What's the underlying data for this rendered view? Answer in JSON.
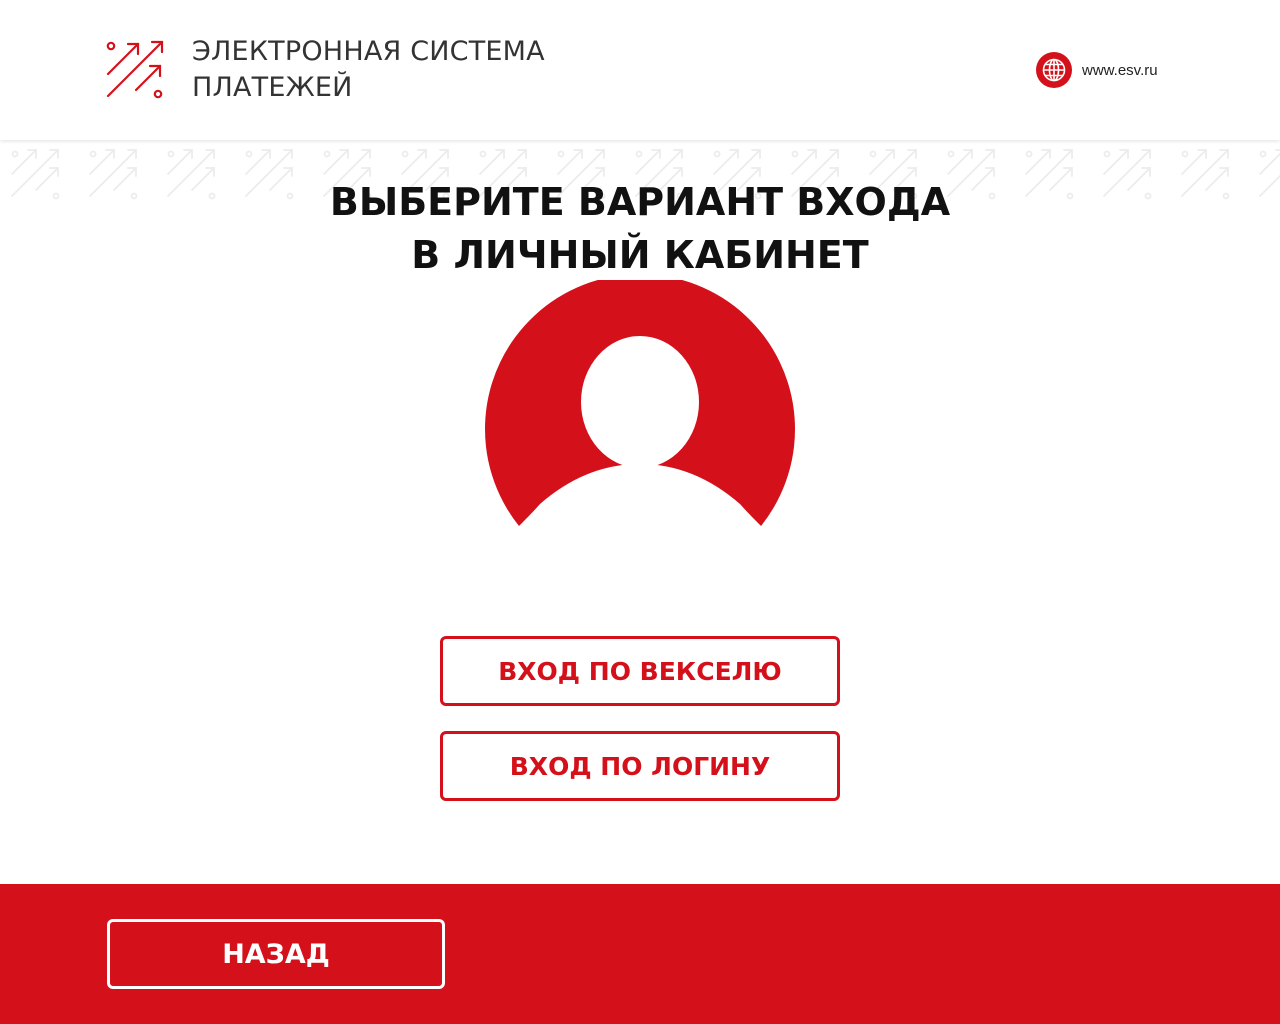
{
  "header": {
    "brand_line1": "ЭЛЕКТРОННАЯ СИСТЕМА",
    "brand_line2": "ПЛАТЕЖЕЙ",
    "site": "www.esv.ru"
  },
  "main": {
    "title_line1": "ВЫБЕРИТЕ ВАРИАНТ ВХОДА",
    "title_line2": "В ЛИЧНЫЙ КАБИНЕТ",
    "option_bill": "ВХОД ПО ВЕКСЕЛЮ",
    "option_login": "ВХОД ПО ЛОГИНУ"
  },
  "footer": {
    "back_label": "НАЗАД"
  },
  "icons": {
    "logo": "arrows-logo-icon",
    "site": "globe-icon",
    "avatar": "user-avatar-icon"
  },
  "colors": {
    "accent": "#d4111b",
    "text": "#111111",
    "background": "#ffffff"
  }
}
